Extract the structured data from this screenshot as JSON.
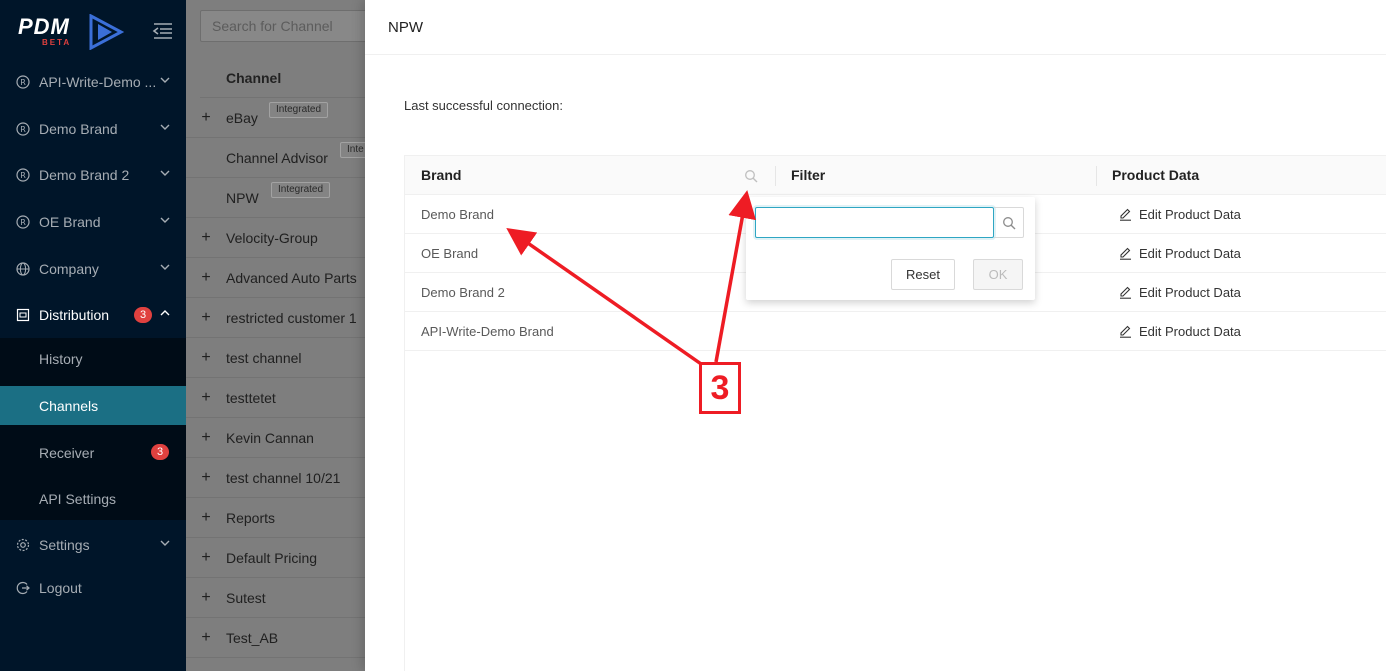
{
  "app": {
    "logo_text": "PDM",
    "logo_badge": "BETA"
  },
  "sidebar": {
    "items": [
      {
        "label": "API-Write-Demo ...",
        "icon": "registered-icon"
      },
      {
        "label": "Demo Brand",
        "icon": "registered-icon"
      },
      {
        "label": "Demo Brand 2",
        "icon": "registered-icon"
      },
      {
        "label": "OE Brand",
        "icon": "registered-icon"
      },
      {
        "label": "Company",
        "icon": "globe-icon"
      },
      {
        "label": "Distribution",
        "icon": "container-icon",
        "badge": "3"
      },
      {
        "label": "Settings",
        "icon": "gear-icon"
      },
      {
        "label": "Logout",
        "icon": "logout-icon"
      }
    ],
    "distribution_sub": [
      {
        "label": "History"
      },
      {
        "label": "Channels"
      },
      {
        "label": "Receiver",
        "badge": "3"
      },
      {
        "label": "API Settings"
      }
    ],
    "selected": "Channels"
  },
  "channels": {
    "search_placeholder": "Search for Channel",
    "header": "Channel",
    "rows": [
      {
        "name": "eBay",
        "tag": "Integrated",
        "expandable": true
      },
      {
        "name": "Channel Advisor",
        "tag": "Inte",
        "expandable": false
      },
      {
        "name": "NPW",
        "tag": "Integrated",
        "expandable": false
      },
      {
        "name": "Velocity-Group",
        "expandable": true
      },
      {
        "name": "Advanced Auto Parts",
        "expandable": true
      },
      {
        "name": "restricted customer 1",
        "expandable": true
      },
      {
        "name": "test channel",
        "expandable": true
      },
      {
        "name": "testtetet",
        "expandable": true
      },
      {
        "name": "Kevin Cannan",
        "expandable": true
      },
      {
        "name": "test channel 10/21",
        "expandable": true
      },
      {
        "name": "Reports",
        "expandable": true
      },
      {
        "name": "Default Pricing",
        "expandable": true
      },
      {
        "name": "Sutest",
        "expandable": true
      },
      {
        "name": "Test_AB",
        "expandable": true
      }
    ],
    "plus_symbol": "+"
  },
  "drawer": {
    "title": "NPW",
    "last_connection_label": "Last successful connection:",
    "table": {
      "columns": [
        "Brand",
        "Filter",
        "Product Data"
      ],
      "rows": [
        {
          "brand": "Demo Brand",
          "action": "Edit Product Data"
        },
        {
          "brand": "OE Brand",
          "action": "Edit Product Data"
        },
        {
          "brand": "Demo Brand 2",
          "action": "Edit Product Data"
        },
        {
          "brand": "API-Write-Demo Brand",
          "action": "Edit Product Data"
        }
      ]
    },
    "filter_dropdown": {
      "input_value": "",
      "reset_label": "Reset",
      "ok_label": "OK"
    }
  },
  "annotation": {
    "step_number": "3",
    "color": "#ee1c24"
  },
  "colors": {
    "sidebar_bg": "#001529",
    "selected_bg": "#1b6f84",
    "accent": "#2ea6c3",
    "badge": "#e0413f"
  }
}
